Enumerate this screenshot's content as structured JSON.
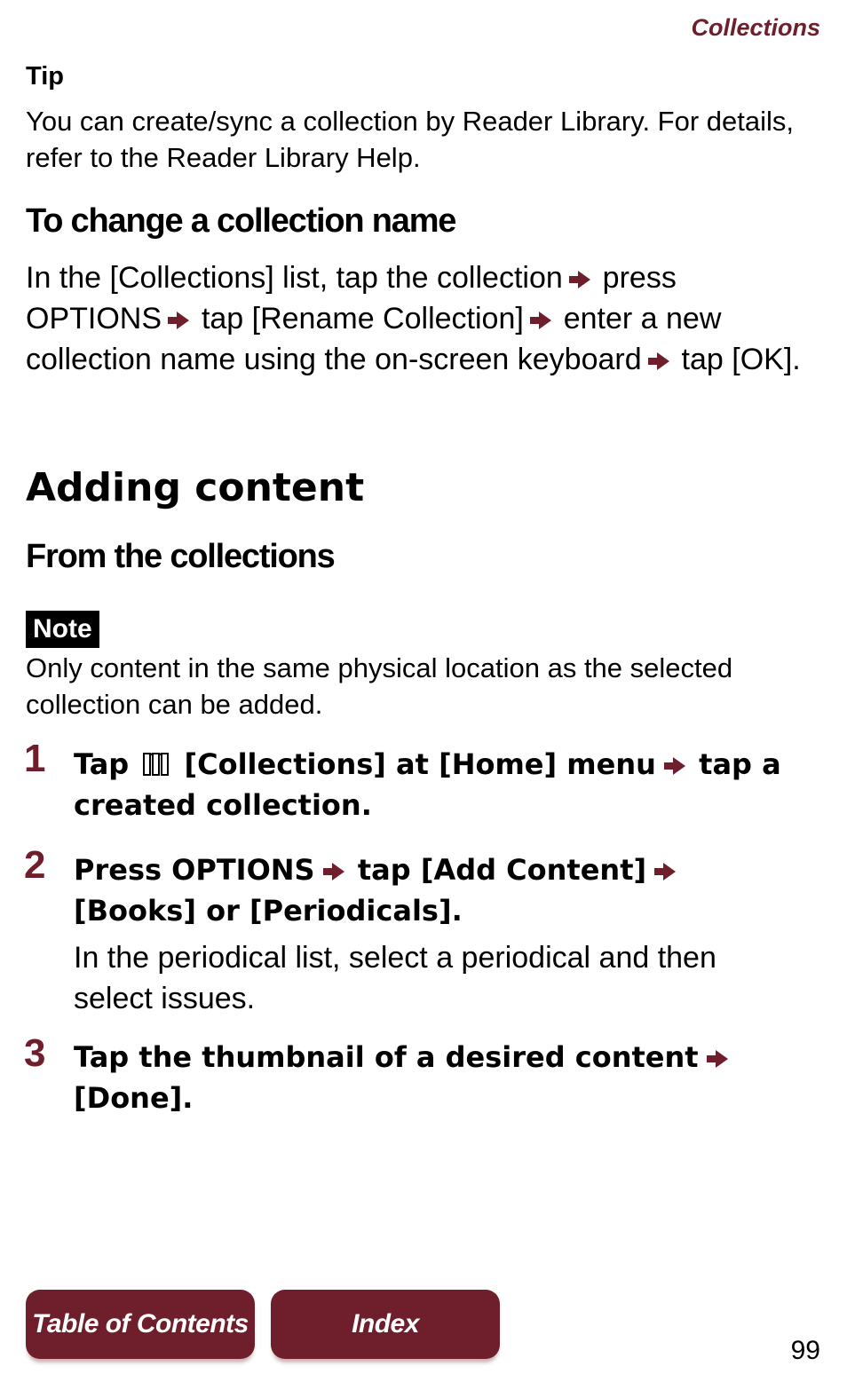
{
  "header": {
    "section_title": "Collections"
  },
  "tip": {
    "label": "Tip",
    "text": "You can create/sync a collection by Reader Library. For details, refer to the Reader Library Help."
  },
  "rename": {
    "heading": "To change a collection name",
    "parts": [
      "In the [Collections] list, tap the collection",
      "press OPTIONS",
      "tap [Rename Collection]",
      "enter a new collection name using the on-screen keyboard",
      "tap [OK]."
    ]
  },
  "adding": {
    "heading": "Adding content",
    "subheading": "From the collections",
    "note_label": "Note",
    "note_text": "Only content in the same physical location as the selected collection can be added."
  },
  "steps": [
    {
      "number": "1",
      "parts": [
        "Tap",
        "[Collections] at [Home] menu",
        "tap a created collection."
      ],
      "icon": "collections-icon"
    },
    {
      "number": "2",
      "parts": [
        "Press OPTIONS",
        "tap [Add Content]",
        "[Books] or [Periodicals]."
      ],
      "sub": "In the periodical list, select a periodical and then select issues."
    },
    {
      "number": "3",
      "parts": [
        "Tap the thumbnail of a desired content",
        "[Done]."
      ]
    }
  ],
  "footer": {
    "toc_label": "Table of Contents",
    "index_label": "Index",
    "page_number": "99"
  },
  "colors": {
    "accent": "#6e1f2b"
  }
}
